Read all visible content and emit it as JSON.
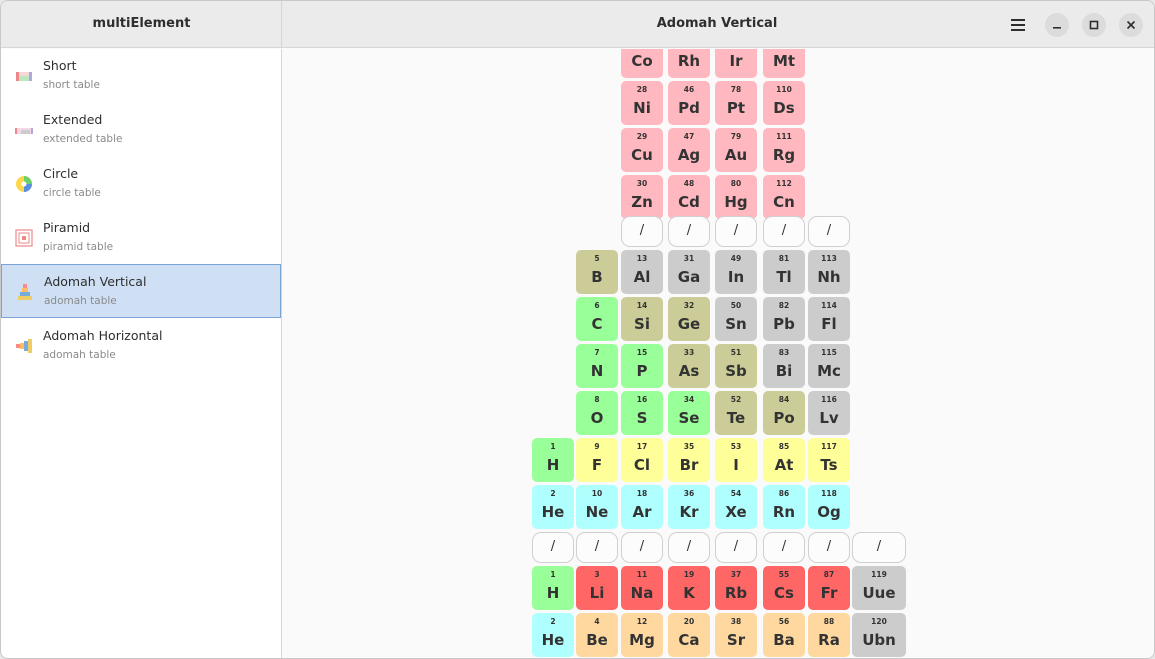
{
  "app": {
    "title": "multiElement",
    "page_title": "Adomah Vertical"
  },
  "colors": {
    "d": "#ffb8bf",
    "p": "#cccccc",
    "m": "#cccc99",
    "n": "#99ff99",
    "h": "#ffff99",
    "g": "#b0ffff",
    "a": "#ff6666",
    "e": "#ffd8a0"
  },
  "header": {
    "menu_icon": "hamburger-menu-icon",
    "minimize_icon": "minimize-icon",
    "maximize_icon": "maximize-icon",
    "close_icon": "close-icon"
  },
  "sidebar": {
    "items": [
      {
        "label": "Short",
        "sub": "short table",
        "icon": "short-table-icon"
      },
      {
        "label": "Extended",
        "sub": "extended table",
        "icon": "extended-table-icon"
      },
      {
        "label": "Circle",
        "sub": "circle table",
        "icon": "circle-table-icon"
      },
      {
        "label": "Piramid",
        "sub": "piramid table",
        "icon": "piramid-table-icon"
      },
      {
        "label": "Adomah Vertical",
        "sub": "adomah table",
        "icon": "adomah-vertical-icon",
        "selected": true
      },
      {
        "label": "Adomah Horizontal",
        "sub": "adomah table",
        "icon": "adomah-horizontal-icon"
      }
    ]
  },
  "table": {
    "rows": [
      {
        "kind": "el",
        "cells": [
          {
            "c": 3,
            "n": "",
            "s": "Co",
            "t": "d"
          },
          {
            "c": 4,
            "n": "",
            "s": "Rh",
            "t": "d"
          },
          {
            "c": 5,
            "n": "",
            "s": "Ir",
            "t": "d"
          },
          {
            "c": 6,
            "n": "",
            "s": "Mt",
            "t": "d"
          }
        ]
      },
      {
        "kind": "el",
        "cells": [
          {
            "c": 3,
            "n": "28",
            "s": "Ni",
            "t": "d"
          },
          {
            "c": 4,
            "n": "46",
            "s": "Pd",
            "t": "d"
          },
          {
            "c": 5,
            "n": "78",
            "s": "Pt",
            "t": "d"
          },
          {
            "c": 6,
            "n": "110",
            "s": "Ds",
            "t": "d"
          }
        ]
      },
      {
        "kind": "el",
        "cells": [
          {
            "c": 3,
            "n": "29",
            "s": "Cu",
            "t": "d"
          },
          {
            "c": 4,
            "n": "47",
            "s": "Ag",
            "t": "d"
          },
          {
            "c": 5,
            "n": "79",
            "s": "Au",
            "t": "d"
          },
          {
            "c": 6,
            "n": "111",
            "s": "Rg",
            "t": "d"
          }
        ]
      },
      {
        "kind": "el",
        "cells": [
          {
            "c": 3,
            "n": "30",
            "s": "Zn",
            "t": "d"
          },
          {
            "c": 4,
            "n": "48",
            "s": "Cd",
            "t": "d"
          },
          {
            "c": 5,
            "n": "80",
            "s": "Hg",
            "t": "d"
          },
          {
            "c": 6,
            "n": "112",
            "s": "Cn",
            "t": "d"
          }
        ]
      },
      {
        "kind": "sep",
        "cells": [
          {
            "c": 3,
            "s": "/"
          },
          {
            "c": 4,
            "s": "/"
          },
          {
            "c": 5,
            "s": "/"
          },
          {
            "c": 6,
            "s": "/"
          },
          {
            "c": 7,
            "s": "/"
          }
        ]
      },
      {
        "kind": "el",
        "cells": [
          {
            "c": 2,
            "n": "5",
            "s": "B",
            "t": "m"
          },
          {
            "c": 3,
            "n": "13",
            "s": "Al",
            "t": "p"
          },
          {
            "c": 4,
            "n": "31",
            "s": "Ga",
            "t": "p"
          },
          {
            "c": 5,
            "n": "49",
            "s": "In",
            "t": "p"
          },
          {
            "c": 6,
            "n": "81",
            "s": "Tl",
            "t": "p"
          },
          {
            "c": 7,
            "n": "113",
            "s": "Nh",
            "t": "p"
          }
        ]
      },
      {
        "kind": "el",
        "cells": [
          {
            "c": 2,
            "n": "6",
            "s": "C",
            "t": "n"
          },
          {
            "c": 3,
            "n": "14",
            "s": "Si",
            "t": "m"
          },
          {
            "c": 4,
            "n": "32",
            "s": "Ge",
            "t": "m"
          },
          {
            "c": 5,
            "n": "50",
            "s": "Sn",
            "t": "p"
          },
          {
            "c": 6,
            "n": "82",
            "s": "Pb",
            "t": "p"
          },
          {
            "c": 7,
            "n": "114",
            "s": "Fl",
            "t": "p"
          }
        ]
      },
      {
        "kind": "el",
        "cells": [
          {
            "c": 2,
            "n": "7",
            "s": "N",
            "t": "n"
          },
          {
            "c": 3,
            "n": "15",
            "s": "P",
            "t": "n"
          },
          {
            "c": 4,
            "n": "33",
            "s": "As",
            "t": "m"
          },
          {
            "c": 5,
            "n": "51",
            "s": "Sb",
            "t": "m"
          },
          {
            "c": 6,
            "n": "83",
            "s": "Bi",
            "t": "p"
          },
          {
            "c": 7,
            "n": "115",
            "s": "Mc",
            "t": "p"
          }
        ]
      },
      {
        "kind": "el",
        "cells": [
          {
            "c": 2,
            "n": "8",
            "s": "O",
            "t": "n"
          },
          {
            "c": 3,
            "n": "16",
            "s": "S",
            "t": "n"
          },
          {
            "c": 4,
            "n": "34",
            "s": "Se",
            "t": "n"
          },
          {
            "c": 5,
            "n": "52",
            "s": "Te",
            "t": "m"
          },
          {
            "c": 6,
            "n": "84",
            "s": "Po",
            "t": "m"
          },
          {
            "c": 7,
            "n": "116",
            "s": "Lv",
            "t": "p"
          }
        ]
      },
      {
        "kind": "el",
        "cells": [
          {
            "c": 1,
            "n": "1",
            "s": "H",
            "t": "n"
          },
          {
            "c": 2,
            "n": "9",
            "s": "F",
            "t": "h"
          },
          {
            "c": 3,
            "n": "17",
            "s": "Cl",
            "t": "h"
          },
          {
            "c": 4,
            "n": "35",
            "s": "Br",
            "t": "h"
          },
          {
            "c": 5,
            "n": "53",
            "s": "I",
            "t": "h"
          },
          {
            "c": 6,
            "n": "85",
            "s": "At",
            "t": "h"
          },
          {
            "c": 7,
            "n": "117",
            "s": "Ts",
            "t": "h"
          }
        ]
      },
      {
        "kind": "el",
        "cells": [
          {
            "c": 1,
            "n": "2",
            "s": "He",
            "t": "g"
          },
          {
            "c": 2,
            "n": "10",
            "s": "Ne",
            "t": "g"
          },
          {
            "c": 3,
            "n": "18",
            "s": "Ar",
            "t": "g"
          },
          {
            "c": 4,
            "n": "36",
            "s": "Kr",
            "t": "g"
          },
          {
            "c": 5,
            "n": "54",
            "s": "Xe",
            "t": "g"
          },
          {
            "c": 6,
            "n": "86",
            "s": "Rn",
            "t": "g"
          },
          {
            "c": 7,
            "n": "118",
            "s": "Og",
            "t": "g"
          }
        ]
      },
      {
        "kind": "sep",
        "cells": [
          {
            "c": 1,
            "s": "/"
          },
          {
            "c": 2,
            "s": "/"
          },
          {
            "c": 3,
            "s": "/"
          },
          {
            "c": 4,
            "s": "/"
          },
          {
            "c": 5,
            "s": "/"
          },
          {
            "c": 6,
            "s": "/"
          },
          {
            "c": 7,
            "s": "/"
          },
          {
            "c": 8,
            "s": "/"
          }
        ]
      },
      {
        "kind": "el",
        "cells": [
          {
            "c": 1,
            "n": "1",
            "s": "H",
            "t": "n"
          },
          {
            "c": 2,
            "n": "3",
            "s": "Li",
            "t": "a"
          },
          {
            "c": 3,
            "n": "11",
            "s": "Na",
            "t": "a"
          },
          {
            "c": 4,
            "n": "19",
            "s": "K",
            "t": "a"
          },
          {
            "c": 5,
            "n": "37",
            "s": "Rb",
            "t": "a"
          },
          {
            "c": 6,
            "n": "55",
            "s": "Cs",
            "t": "a"
          },
          {
            "c": 7,
            "n": "87",
            "s": "Fr",
            "t": "a"
          },
          {
            "c": 8,
            "n": "119",
            "s": "Uue",
            "t": "p"
          }
        ]
      },
      {
        "kind": "el",
        "cells": [
          {
            "c": 1,
            "n": "2",
            "s": "He",
            "t": "g"
          },
          {
            "c": 2,
            "n": "4",
            "s": "Be",
            "t": "e"
          },
          {
            "c": 3,
            "n": "12",
            "s": "Mg",
            "t": "e"
          },
          {
            "c": 4,
            "n": "20",
            "s": "Ca",
            "t": "e"
          },
          {
            "c": 5,
            "n": "38",
            "s": "Sr",
            "t": "e"
          },
          {
            "c": 6,
            "n": "56",
            "s": "Ba",
            "t": "e"
          },
          {
            "c": 7,
            "n": "88",
            "s": "Ra",
            "t": "e"
          },
          {
            "c": 8,
            "n": "120",
            "s": "Ubn",
            "t": "p"
          }
        ]
      }
    ]
  }
}
